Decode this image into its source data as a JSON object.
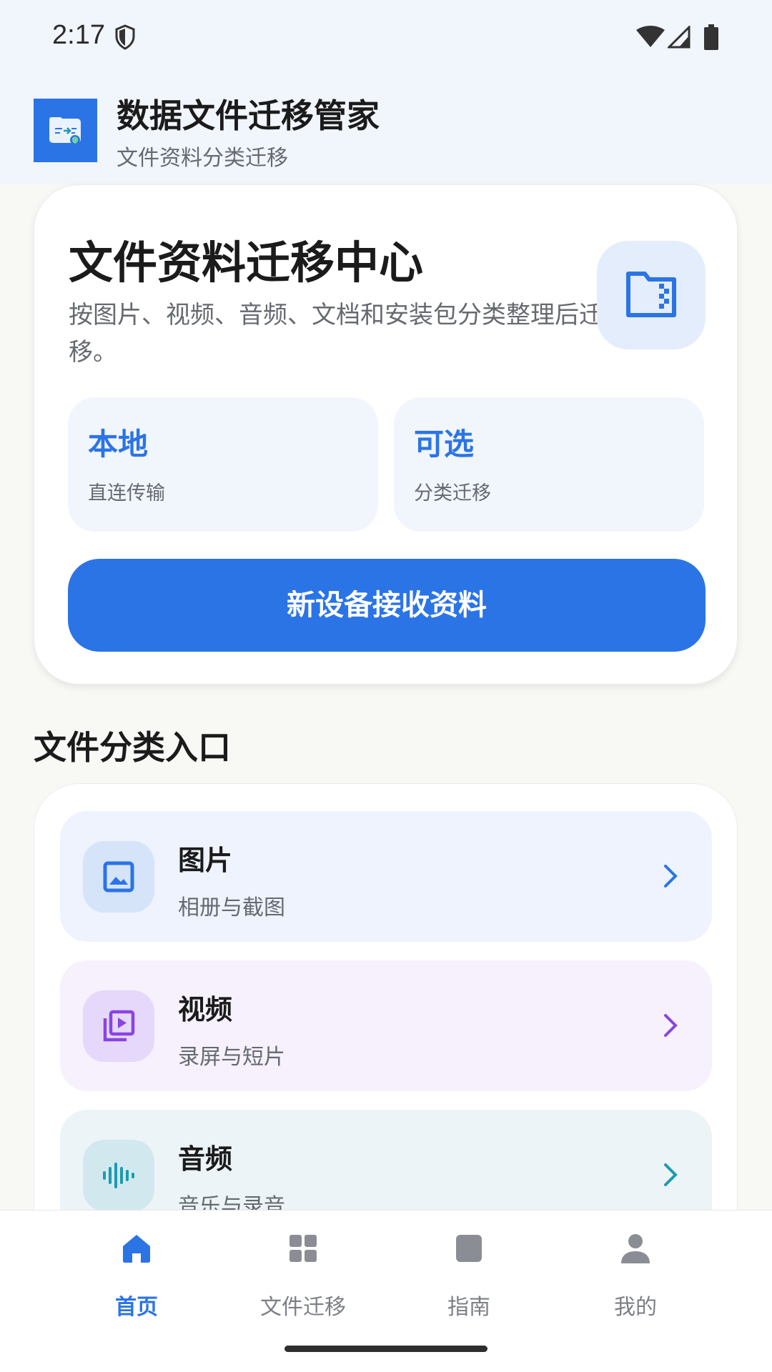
{
  "status_bar": {
    "time": "2:17"
  },
  "header": {
    "title": "数据文件迁移管家",
    "subtitle": "文件资料分类迁移"
  },
  "hero": {
    "title": "文件资料迁移中心",
    "description": "按图片、视频、音频、文档和安装包分类整理后迁移。",
    "stats": [
      {
        "value": "本地",
        "label": "直连传输"
      },
      {
        "value": "可选",
        "label": "分类迁移"
      }
    ],
    "button_label": "新设备接收资料"
  },
  "categories_section": {
    "title": "文件分类入口",
    "items": [
      {
        "name": "图片",
        "desc": "相册与截图",
        "icon": "image-icon",
        "accent": "#2B74E6"
      },
      {
        "name": "视频",
        "desc": "录屏与短片",
        "icon": "video-library-icon",
        "accent": "#8A44E0"
      },
      {
        "name": "音频",
        "desc": "音乐与录音",
        "icon": "audio-wave-icon",
        "accent": "#1E9AAE"
      }
    ]
  },
  "bottom_nav": {
    "items": [
      {
        "label": "首页",
        "icon": "home-icon",
        "active": true
      },
      {
        "label": "文件迁移",
        "icon": "grid-icon",
        "active": false
      },
      {
        "label": "指南",
        "icon": "book-icon",
        "active": false
      },
      {
        "label": "我的",
        "icon": "person-icon",
        "active": false
      }
    ]
  },
  "colors": {
    "primary": "#2B74E6",
    "background": "#F8F8F5",
    "header_bg": "#F1F5FC"
  }
}
